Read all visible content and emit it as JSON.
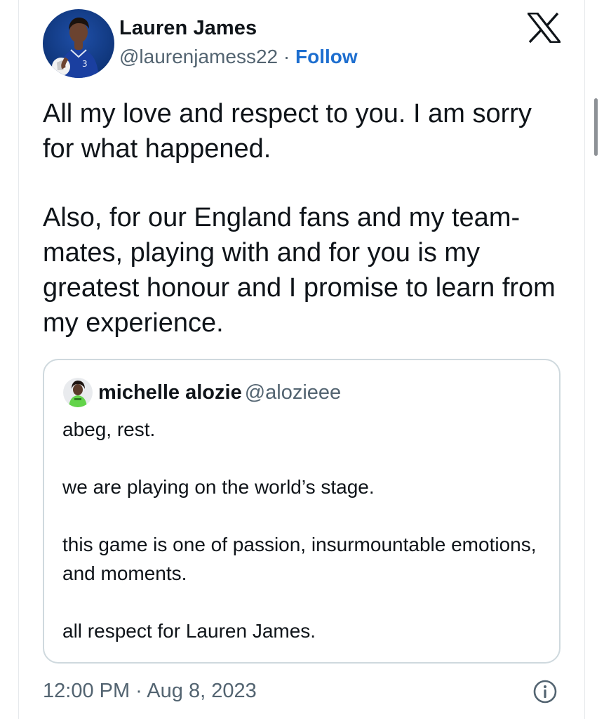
{
  "tweet": {
    "author_name": "Lauren James",
    "handle": "@laurenjamess22",
    "separator": " · ",
    "follow_label": "Follow",
    "paragraphs": [
      "All my love and respect to you. I am sorry for what happened.",
      "Also, for our England fans and my team-mates, playing with and for you is my greatest honour and I promise to learn from my experience."
    ],
    "timestamp": "12:00 PM · Aug 8, 2023"
  },
  "quoted_tweet": {
    "author_name": "michelle alozie",
    "handle": "@alozieee",
    "paragraphs": [
      "abeg, rest.",
      "we are playing on the world’s stage.",
      "this game is one of passion, insurmountable emotions, and moments.",
      "all respect for Lauren James."
    ]
  },
  "icons": {
    "logo": "x-logo-icon",
    "info": "info-icon"
  },
  "colors": {
    "text": "#0f1419",
    "secondary_text": "#536471",
    "follow_link": "#1d6ecf",
    "border": "#cfd9de"
  }
}
